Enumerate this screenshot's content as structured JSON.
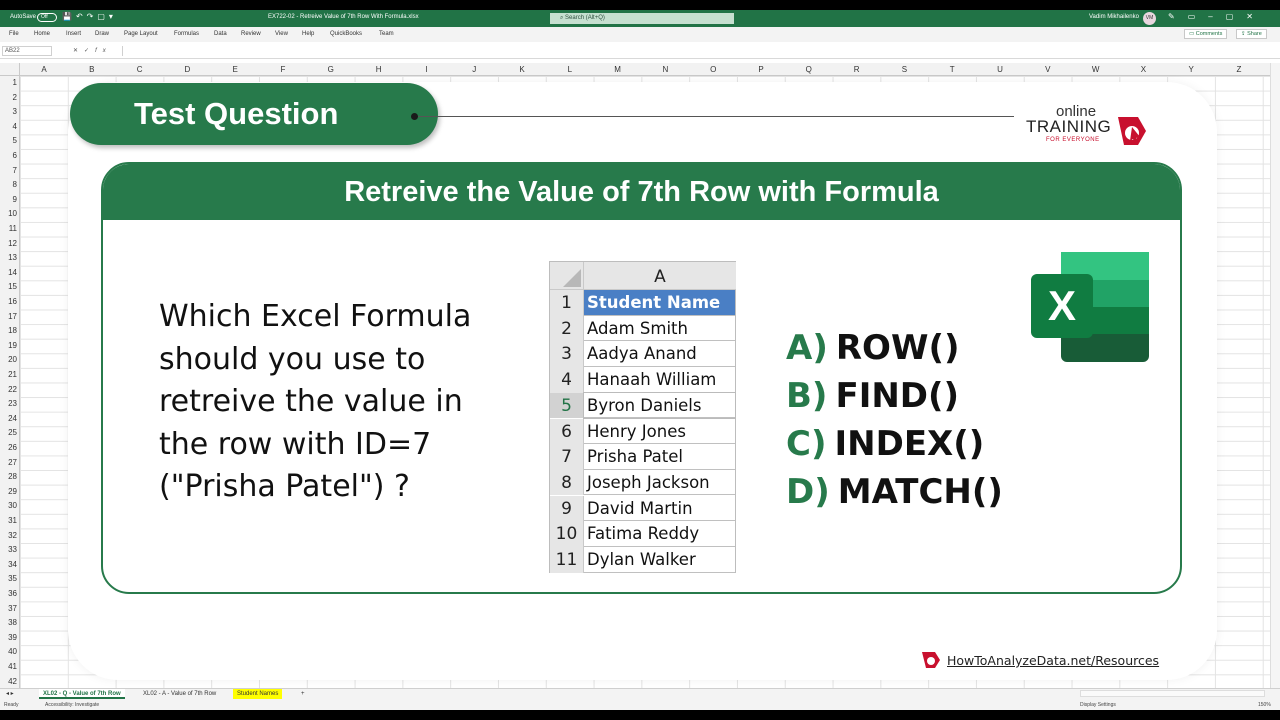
{
  "titlebar": {
    "autosave": "AutoSave",
    "autosave_state": "Off",
    "doc_title": "EX722-02 - Retreive Value of 7th Row With Formula.xlsx",
    "search_placeholder": "Search (Alt+Q)",
    "user": "Vadim Mikhailenko",
    "user_initials": "VM"
  },
  "menu": {
    "items": [
      "File",
      "Home",
      "Insert",
      "Draw",
      "Page Layout",
      "Formulas",
      "Data",
      "Review",
      "View",
      "Help",
      "QuickBooks",
      "Team"
    ],
    "comments": "Comments",
    "share": "Share"
  },
  "formula_bar": {
    "name_box": "AB22",
    "fx": "fx",
    "value": ""
  },
  "grid": {
    "columns": [
      "A",
      "B",
      "C",
      "D",
      "E",
      "F",
      "G",
      "H",
      "I",
      "J",
      "K",
      "L",
      "M",
      "N",
      "O",
      "P",
      "Q",
      "R",
      "S",
      "T",
      "U",
      "V",
      "W",
      "X",
      "Y",
      "Z"
    ],
    "rows": [
      "1",
      "2",
      "3",
      "4",
      "5",
      "6",
      "7",
      "8",
      "9",
      "10",
      "11",
      "12",
      "13",
      "14",
      "15",
      "16",
      "17",
      "18",
      "19",
      "20",
      "21",
      "22",
      "23",
      "24",
      "25",
      "26",
      "27",
      "28",
      "29",
      "30",
      "31",
      "32",
      "33",
      "34",
      "35",
      "36",
      "37",
      "38",
      "39",
      "40",
      "41",
      "42"
    ]
  },
  "slide": {
    "pill_title": "Test Question",
    "logo": {
      "online": "online",
      "training": "TRAINING",
      "tagline": "FOR EVERYONE"
    },
    "card_title": "Retreive the Value of 7th Row with Formula",
    "question": "Which Excel Formula should you use to retreive the value in the row with ID=7 (\"Prisha Patel\") ?",
    "mini_sheet": {
      "column": "A",
      "rows": [
        {
          "n": "1",
          "v": "Student Name"
        },
        {
          "n": "2",
          "v": "Adam Smith"
        },
        {
          "n": "3",
          "v": "Aadya Anand"
        },
        {
          "n": "4",
          "v": "Hanaah William"
        },
        {
          "n": "5",
          "v": "Byron Daniels"
        },
        {
          "n": "6",
          "v": "Henry Jones"
        },
        {
          "n": "7",
          "v": "Prisha Patel"
        },
        {
          "n": "8",
          "v": "Joseph Jackson"
        },
        {
          "n": "9",
          "v": "David Martin"
        },
        {
          "n": "10",
          "v": "Fatima Reddy"
        },
        {
          "n": "11",
          "v": "Dylan Walker"
        }
      ]
    },
    "answers": [
      {
        "letter": "A)",
        "text": "ROW()"
      },
      {
        "letter": "B)",
        "text": "FIND()"
      },
      {
        "letter": "C)",
        "text": "INDEX()"
      },
      {
        "letter": "D)",
        "text": "MATCH()"
      }
    ],
    "excel_icon_letter": "X",
    "resources": "HowToAnalyzeData.net/Resources"
  },
  "sheets": [
    {
      "label": "XL02 - Q - Value of 7th Row",
      "state": "active"
    },
    {
      "label": "XL02 - A - Value of 7th Row",
      "state": "normal"
    },
    {
      "label": "Student Names",
      "state": "yellow"
    }
  ],
  "add_sheet": "+",
  "status": {
    "ready": "Ready",
    "accessibility": "Accessibility: Investigate",
    "display": "Display Settings",
    "zoom": "150%"
  },
  "colors": {
    "excel_green": "#217346",
    "slide_green": "#277a4b",
    "header_blue": "#4a7fc5"
  }
}
